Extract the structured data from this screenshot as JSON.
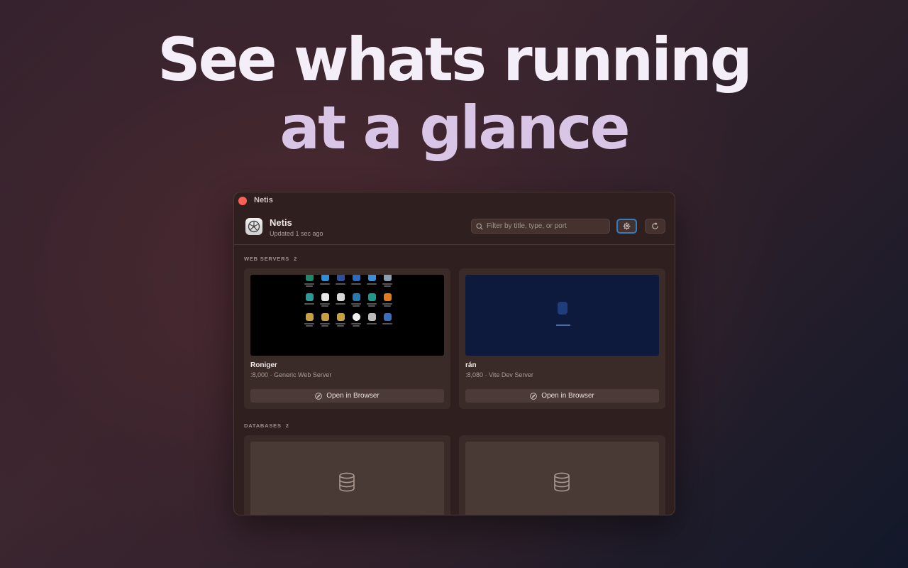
{
  "hero": {
    "line1": "See whats running",
    "line2": "at a glance"
  },
  "window": {
    "title": "Netis"
  },
  "header": {
    "app_name": "Netis",
    "updated": "Updated 1 sec ago",
    "search_placeholder": "Filter by title, type, or port"
  },
  "sections": [
    {
      "label": "WEB SERVERS",
      "count": "2",
      "cards": [
        {
          "title": "Roniger",
          "subtitle": ":8,000 · Generic Web Server",
          "button": "Open in Browser"
        },
        {
          "title": "rán",
          "subtitle": ":8,080 · Vite Dev Server",
          "button": "Open in Browser"
        }
      ]
    },
    {
      "label": "DATABASES",
      "count": "2",
      "cards": [
        {},
        {}
      ]
    }
  ],
  "icons": {
    "close": "close-dot",
    "app": "netis-app-icon",
    "search": "search-icon",
    "settings": "gear-icon",
    "refresh": "refresh-icon",
    "compass": "compass-icon",
    "database": "database-icon"
  },
  "colors": {
    "accent": "#2f7fc1",
    "close": "#ff5f57"
  }
}
